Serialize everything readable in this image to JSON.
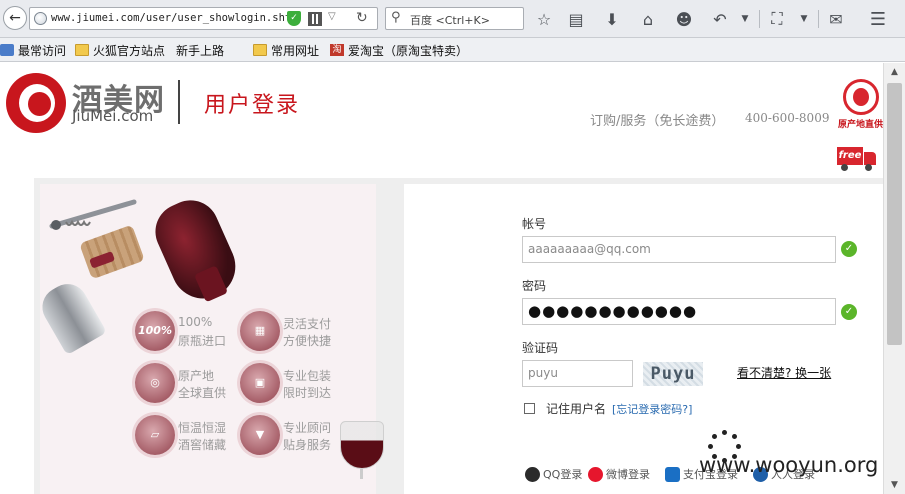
{
  "browser": {
    "url": "www.jiumei.com/user/user_showlogin.sht",
    "search_placeholder": "百度 <Ctrl+K>"
  },
  "bookmarks": [
    {
      "label": "最常访问",
      "icon": "gear-icon"
    },
    {
      "label": "火狐官方站点",
      "icon": "folder-icon"
    },
    {
      "label": "新手上路",
      "icon": "page-icon"
    },
    {
      "label": "常用网址",
      "icon": "folder-icon"
    },
    {
      "label": "爱淘宝（原淘宝特卖）",
      "icon": "taobao-icon"
    }
  ],
  "header": {
    "logo_cn": "酒美网",
    "logo_en": "JiuMei.com",
    "page_title": "用户登录",
    "hotline_label": "订购/服务（免长途费）",
    "hotline_number": "400-600-8009",
    "origin_badge_text": "原产地直供",
    "free_shipping_text": "free"
  },
  "promo": {
    "features": [
      {
        "badge": "100%",
        "line1": "100%",
        "line2": "原瓶进口"
      },
      {
        "badge": "",
        "line1": "灵活支付",
        "line2": "方便快捷"
      },
      {
        "badge": "",
        "line1": "原产地",
        "line2": "全球直供"
      },
      {
        "badge": "",
        "line1": "专业包装",
        "line2": "限时到达"
      },
      {
        "badge": "",
        "line1": "恒温恒湿",
        "line2": "酒窖储藏"
      },
      {
        "badge": "",
        "line1": "专业顾问",
        "line2": "贴身服务"
      }
    ]
  },
  "form": {
    "account_label": "帐号",
    "account_value": "aaaaaaaaa@qq.com",
    "password_label": "密码",
    "password_value": "●●●●●●●●●●●●",
    "captcha_label": "验证码",
    "captcha_value": "puyu",
    "captcha_image_text": "Puyu",
    "refresh_link": "看不清楚? 换一张",
    "remember_label": "记住用户名",
    "forgot_link": "[忘记登录密码?]"
  },
  "social_login": [
    {
      "label": "QQ登录"
    },
    {
      "label": "微博登录"
    },
    {
      "label": "支付宝登录"
    },
    {
      "label": "人人登录"
    }
  ],
  "watermark": "www.wooyun.org",
  "colors": {
    "brand_red": "#c8161d",
    "success_green": "#5bb52a",
    "link_blue": "#2a6bb0"
  }
}
